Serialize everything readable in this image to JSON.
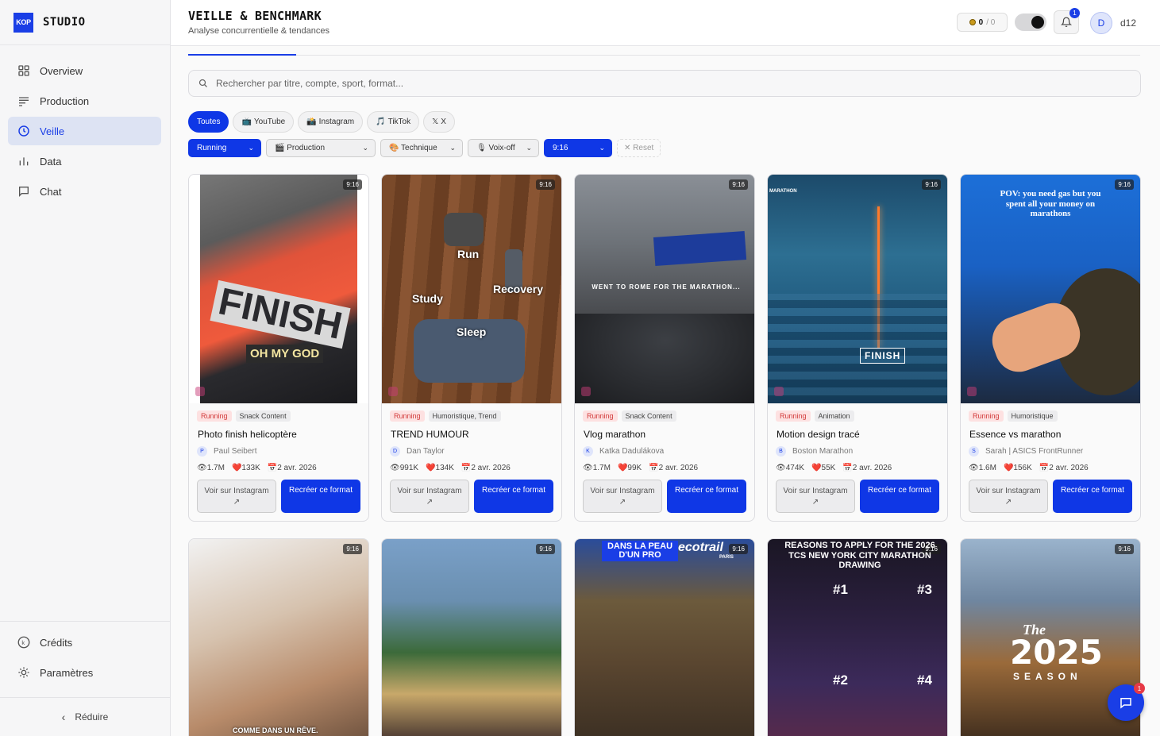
{
  "brand": {
    "logo": "KOP",
    "name": "STUDIO"
  },
  "nav": [
    {
      "label": "Overview",
      "icon": "grid-icon"
    },
    {
      "label": "Production",
      "icon": "lines-icon"
    },
    {
      "label": "Veille",
      "icon": "clock-icon",
      "active": true
    },
    {
      "label": "Data",
      "icon": "bar-chart-icon"
    },
    {
      "label": "Chat",
      "icon": "chat-icon"
    }
  ],
  "nav_bottom": [
    {
      "label": "Crédits",
      "icon": "k-coin-icon"
    },
    {
      "label": "Paramètres",
      "icon": "sun-icon"
    }
  ],
  "collapse_label": "Réduire",
  "header": {
    "title": "VEILLE & BENCHMARK",
    "subtitle": "Analyse concurrentielle & tendances",
    "credits_used": "0",
    "credits_total": "/ 0",
    "notif_count": "1",
    "avatar_letter": "D",
    "username": "d12"
  },
  "search": {
    "placeholder": "Rechercher par titre, compte, sport, format..."
  },
  "platform_chips": [
    {
      "label": "Toutes",
      "active": true
    },
    {
      "label": "YouTube",
      "icon": "📺"
    },
    {
      "label": "Instagram",
      "icon": "📸"
    },
    {
      "label": "TikTok",
      "icon": "🎵"
    },
    {
      "label": "X",
      "icon": "𝕏"
    }
  ],
  "filters": {
    "sport": "Running",
    "production": "🎬 Production",
    "technique": "🎨 Technique",
    "voiceover": "🎙 Voix-off",
    "format": "9:16",
    "reset": "✕ Reset"
  },
  "card_labels": {
    "view": "Voir sur Instagram",
    "view_arrow": "↗",
    "recreate": "Recréer ce format",
    "format": "9:16"
  },
  "cards": [
    {
      "sport": "Running",
      "category": "Snack Content",
      "title": "Photo finish helicoptère",
      "author": "Paul Seibert",
      "author_initial": "P",
      "views": "1.7M",
      "likes": "133K",
      "date": "2 avr. 2026",
      "overlay": "OH MY GOD"
    },
    {
      "sport": "Running",
      "category": "Humoristique, Trend",
      "title": "TREND HUMOUR",
      "author": "Dan Taylor",
      "author_initial": "D",
      "views": "991K",
      "likes": "134K",
      "date": "2 avr. 2026",
      "overlay_words": [
        "Run",
        "Study",
        "Recovery",
        "Sleep"
      ]
    },
    {
      "sport": "Running",
      "category": "Snack Content",
      "title": "Vlog marathon",
      "author": "Katka Dadulákova",
      "author_initial": "K",
      "views": "1.7M",
      "likes": "99K",
      "date": "2 avr. 2026",
      "overlay": "WENT TO ROME FOR THE MARATHON..."
    },
    {
      "sport": "Running",
      "category": "Animation",
      "title": "Motion design tracé",
      "author": "Boston Marathon",
      "author_initial": "B",
      "views": "474K",
      "likes": "55K",
      "date": "2 avr. 2026",
      "overlay": "FINISH",
      "corner_text": "MARATHON"
    },
    {
      "sport": "Running",
      "category": "Humoristique",
      "title": "Essence vs marathon",
      "author": "Sarah | ASICS FrontRunner",
      "author_initial": "S",
      "views": "1.6M",
      "likes": "156K",
      "date": "2 avr. 2026",
      "overlay": "POV: you need gas but you spent all your money on marathons"
    }
  ],
  "row2": [
    {
      "overlay": "COMME DANS UN RÊVE."
    },
    {
      "overlay": ""
    },
    {
      "overlay": "DANS LA PEAU D'UN PRO",
      "brand": "ecotrail",
      "brand_sub": "PARIS"
    },
    {
      "overlay": "REASONS TO APPLY FOR THE 2026 TCS NEW YORK CITY MARATHON DRAWING",
      "nums": [
        "#1",
        "#3",
        "#2",
        "#4"
      ]
    },
    {
      "overlay": "2025",
      "sub": "SEASON",
      "script": "The"
    }
  ],
  "chat_badge": "1"
}
